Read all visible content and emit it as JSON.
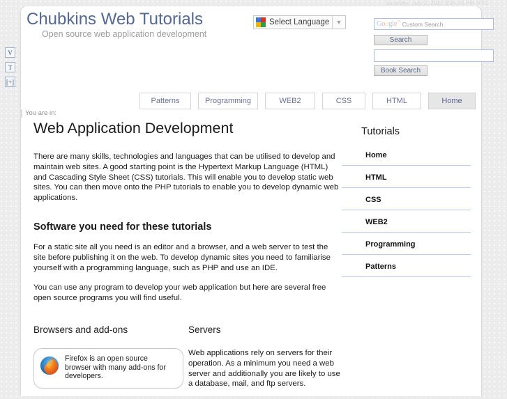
{
  "timestamp": "Saturday, July 2, 2011 3:34:34 PM UTC",
  "accessibility": {
    "items": [
      {
        "label": "V",
        "name": "view-toggle"
      },
      {
        "label": "T",
        "name": "text-toggle"
      },
      {
        "label": "[+]",
        "name": "zoom-in-toggle"
      }
    ]
  },
  "header": {
    "title": "Chubkins Web Tutorials",
    "subtitle": "Open source web application development",
    "translate": {
      "label": "Select Language",
      "caret": "▼"
    },
    "search": {
      "google_logo": "Google",
      "google_tm": "™",
      "custom_search_placeholder": "Custom Search",
      "search_button": "Search",
      "book_input_value": "",
      "book_search_button": "Book Search"
    }
  },
  "nav": {
    "tabs": [
      {
        "label": "Patterns",
        "active": false
      },
      {
        "label": "Programming",
        "active": false
      },
      {
        "label": "WEB2",
        "active": false
      },
      {
        "label": "CSS",
        "active": false
      },
      {
        "label": "HTML",
        "active": false
      },
      {
        "label": "Home",
        "active": true
      }
    ]
  },
  "breadcrumb": "You are in:",
  "main": {
    "page_title": "Web Application Development",
    "intro_paragraph": "There are many skills, technologies and languages that can be utilised to develop and maintain web sites. A good starting point is the Hypertext Markup Language (HTML) and Cascading Style Sheet (CSS) tutorials. This will enable you to develop static web sites. You can then move onto the PHP tutorials to enable you to develop dynamic web applications.",
    "software_heading": "Software you need for these tutorials",
    "software_paragraph_1": "For a static site all you need is an editor and a browser, and a web server to test the site before publishing it on the web. To develop dynamic sites you need to familiarise yourself with a programming language, such as PHP and use an IDE.",
    "software_paragraph_2": "You can use any program to develop your web application but here are several free open source programs you will find useful.",
    "columns": {
      "left_title": "Browsers and add-ons",
      "firefox_promo": "Firefox is an open source browser with many add-ons for developers.",
      "right_title": "Servers",
      "servers_paragraph": "Web applications rely on servers for their operation. As a minimum you need a web server and additionally you are likely to use a database, mail, and ftp servers."
    }
  },
  "sidebar": {
    "title": "Tutorials",
    "links": [
      {
        "label": "Home"
      },
      {
        "label": "HTML"
      },
      {
        "label": "CSS"
      },
      {
        "label": "WEB2"
      },
      {
        "label": "Programming"
      },
      {
        "label": "Patterns"
      }
    ]
  },
  "colors": {
    "title_blue": "#54698f",
    "tab_text": "#6a6f99",
    "sidebar_rule": "#b9cde2",
    "page_bg": "#ececed"
  }
}
